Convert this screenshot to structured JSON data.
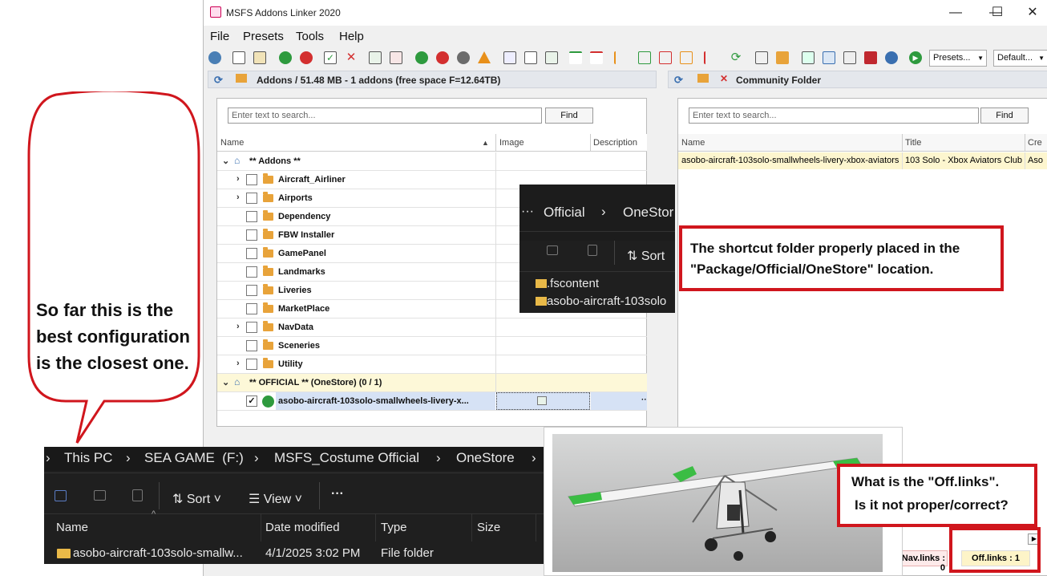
{
  "window": {
    "title": "MSFS Addons Linker 2020",
    "minimize": "—",
    "maximize": "☐",
    "close": "✕"
  },
  "menu": [
    "File",
    "Presets",
    "Tools",
    "Help"
  ],
  "toolbar": {
    "presets_dropdown": "Presets...",
    "default_dropdown": "Default..."
  },
  "left_pane": {
    "header": "Addons / 51.48 MB - 1 addons (free space F=12.64TB)",
    "search_placeholder": "Enter text to search...",
    "find_label": "Find",
    "columns": [
      "Name",
      "Image",
      "Description"
    ],
    "rows": [
      {
        "label": "** Addons **",
        "type": "root"
      },
      {
        "label": "Aircraft_Airliner",
        "expand": true
      },
      {
        "label": "Airports",
        "expand": true
      },
      {
        "label": "Dependency",
        "expand": false
      },
      {
        "label": "FBW Installer",
        "expand": false
      },
      {
        "label": "GamePanel",
        "expand": false
      },
      {
        "label": "Landmarks",
        "expand": false
      },
      {
        "label": "Liveries",
        "expand": false
      },
      {
        "label": "MarketPlace",
        "expand": false
      },
      {
        "label": "NavData",
        "expand": true
      },
      {
        "label": "Sceneries",
        "expand": false
      },
      {
        "label": "Utility",
        "expand": true
      },
      {
        "label": "** OFFICIAL ** (OneStore) (0 / 1)",
        "type": "root"
      },
      {
        "label": "asobo-aircraft-103solo-smallwheels-livery-x...",
        "type": "addon"
      }
    ]
  },
  "right_pane": {
    "header": "Community Folder",
    "search_placeholder": "Enter text to search...",
    "find_label": "Find",
    "columns": [
      "Name",
      "Title",
      "Cre"
    ],
    "row": {
      "name": "asobo-aircraft-103solo-smallwheels-livery-xbox-aviators",
      "title": "103 Solo - Xbox Aviators Club",
      "creator": "Aso"
    }
  },
  "status": {
    "nav_links": "Nav.links : 0",
    "off_links": "Off.links : 1"
  },
  "explorer_small": {
    "crumb1": "Official",
    "crumb2": "OneStor",
    "sort": "Sort",
    "items": [
      ".fscontent",
      "asobo-aircraft-103solo"
    ]
  },
  "explorer_big": {
    "breadcrumb": [
      "This PC",
      "SEA GAME  (F:)",
      "MSFS_Costume Official",
      "OneStore"
    ],
    "sort": "Sort",
    "view": "View",
    "more": "···",
    "columns": [
      "Name",
      "Date modified",
      "Type",
      "Size"
    ],
    "row": {
      "name": "asobo-aircraft-103solo-smallw...",
      "date": "4/1/2025 3:02 PM",
      "type": "File folder"
    }
  },
  "annotations": {
    "speech": "So far this is the best configuration is the closest one.",
    "shortcut_note": "The shortcut folder properly placed in the \"Package/Official/OneStore\" location.",
    "question_line1": "What is the \"Off.links\".",
    "question_line2": "Is it not proper/correct?"
  }
}
